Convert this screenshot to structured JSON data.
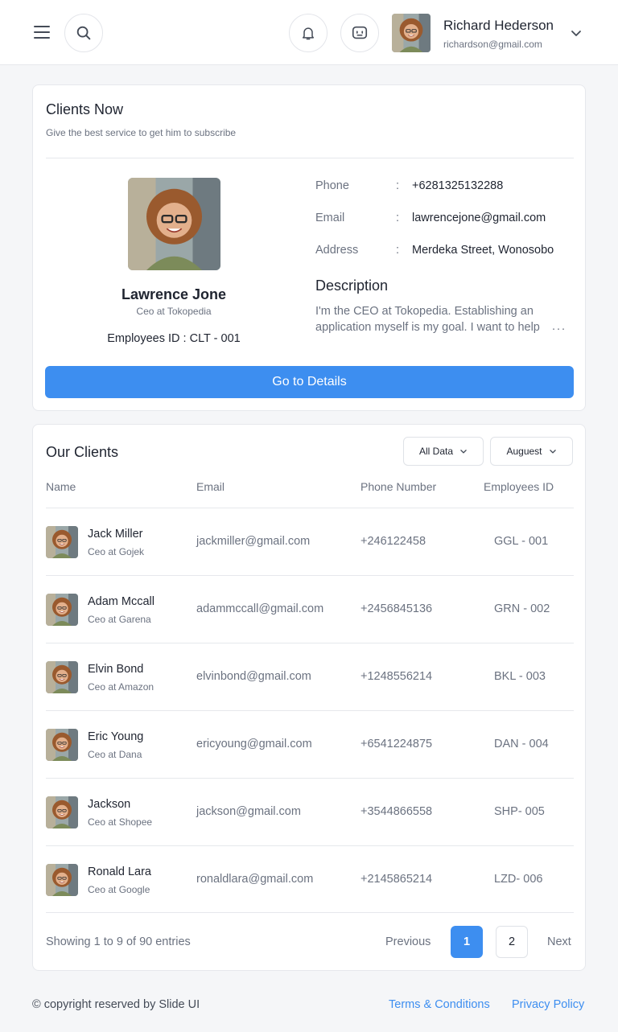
{
  "header": {
    "user_name": "Richard Hederson",
    "user_email": "richardson@gmail.com",
    "icons": [
      "menu-icon",
      "search-icon",
      "bell-icon",
      "chat-icon",
      "chevron-down-icon"
    ]
  },
  "clients_now": {
    "title": "Clients Now",
    "subtitle": "Give the best service to get him to subscribe",
    "name": "Lawrence Jone",
    "role": "Ceo at Tokopedia",
    "employee_id": "Employees ID : CLT - 001",
    "phone_label": "Phone",
    "phone": "+6281325132288",
    "email_label": "Email",
    "email": "lawrencejone@gmail.com",
    "address_label": "Address",
    "address": "Merdeka Street, Wonosobo",
    "colon": ":",
    "description_title": "Description",
    "description": "I'm the CEO at Tokopedia. Establishing an application myself is my goal. I want to help",
    "description_more": "...",
    "button": "Go to Details"
  },
  "our_clients": {
    "title": "Our Clients",
    "filter_all": "All Data",
    "filter_month": "Auguest",
    "columns": [
      "Name",
      "Email",
      "Phone Number",
      "Employees ID"
    ],
    "rows": [
      {
        "name": "Jack Miller",
        "role": "Ceo at Gojek",
        "email": "jackmiller@gmail.com",
        "phone": "+246122458",
        "id": "GGL - 001"
      },
      {
        "name": "Adam Mccall",
        "role": "Ceo at Garena",
        "email": "adammccall@gmail.com",
        "phone": "+2456845136",
        "id": "GRN - 002"
      },
      {
        "name": "Elvin Bond",
        "role": "Ceo at Amazon",
        "email": "elvinbond@gmail.com",
        "phone": "+1248556214",
        "id": "BKL - 003"
      },
      {
        "name": "Eric Young",
        "role": "Ceo at Dana",
        "email": "ericyoung@gmail.com",
        "phone": "+6541224875",
        "id": "DAN - 004"
      },
      {
        "name": "Jackson",
        "role": "Ceo at Shopee",
        "email": "jackson@gmail.com",
        "phone": "+3544866558",
        "id": "SHP- 005"
      },
      {
        "name": "Ronald Lara",
        "role": "Ceo at Google",
        "email": "ronaldlara@gmail.com",
        "phone": "+2145865214",
        "id": "LZD- 006"
      }
    ],
    "showing": "Showing 1 to 9 of 90 entries",
    "previous": "Previous",
    "page1": "1",
    "page2": "2",
    "next": "Next"
  },
  "footer": {
    "copyright": "© copyright reserved by Slide UI",
    "terms": "Terms & Conditions",
    "privacy": "Privacy Policy"
  },
  "colors": {
    "accent": "#3d8ef0",
    "background": "#f5f6f8",
    "card": "#ffffff",
    "text": "#1f2430",
    "muted": "#6b7280"
  }
}
